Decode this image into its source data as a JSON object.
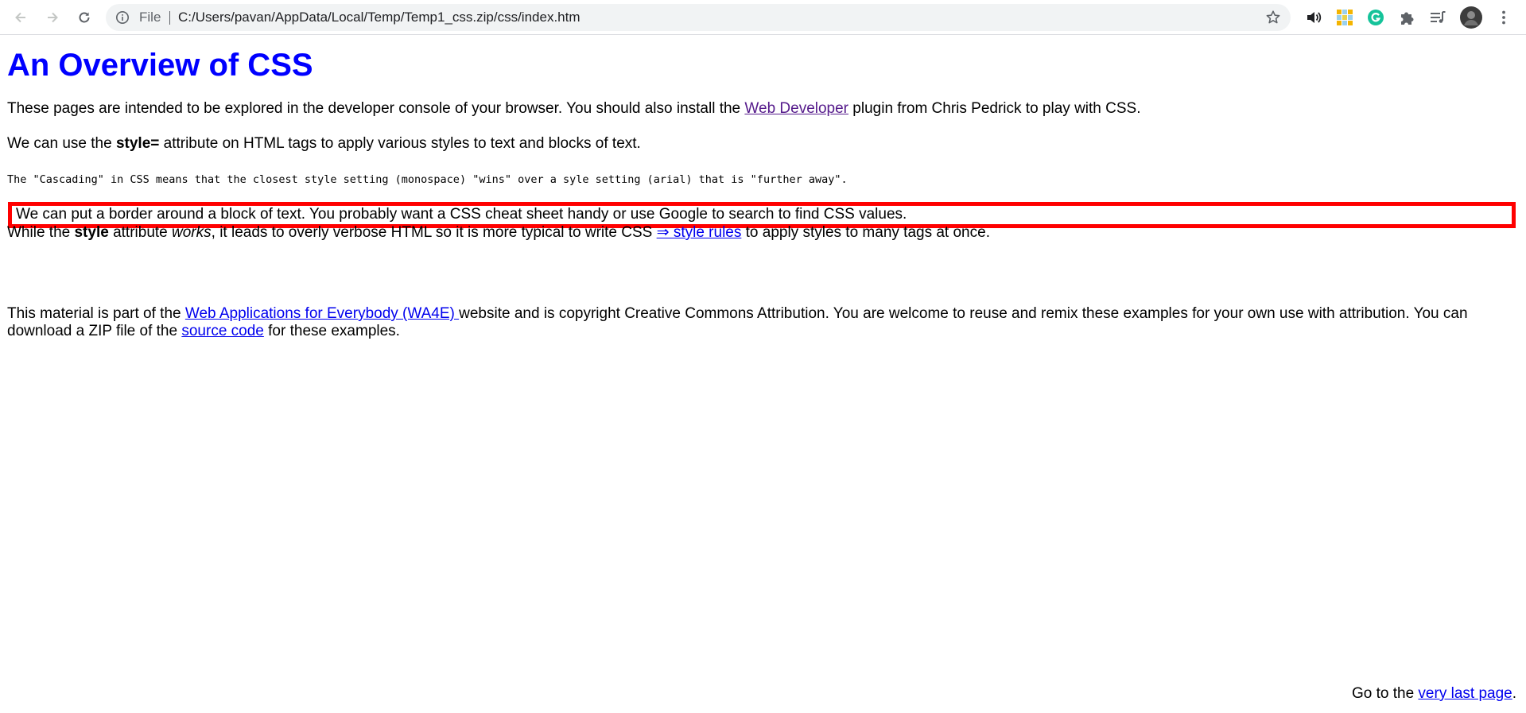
{
  "browser": {
    "url_scheme": "File",
    "url": "C:/Users/pavan/AppData/Local/Temp/Temp1_css.zip/css/index.htm"
  },
  "icons": {
    "back": "arrow-left-icon",
    "forward": "arrow-right-icon",
    "reload": "reload-icon",
    "info": "info-icon",
    "bookmark": "star-icon",
    "audio": "speaker-icon",
    "extension_color": "colorful-extension-icon",
    "grammarly": "grammarly-icon",
    "extensions": "puzzle-icon",
    "media": "media-queue-icon",
    "profile": "avatar",
    "menu": "kebab-menu-icon"
  },
  "colors": {
    "heading": "#0000ff",
    "border_box": "#ff0000",
    "link": "#0000ee",
    "visited_link": "#551a8b",
    "grammarly_green": "#15c39a"
  },
  "content": {
    "title": "An Overview of CSS",
    "p1": {
      "before": "These pages are intended to be explored in the developer console of your browser. You should also install the ",
      "link": "Web Developer",
      "after": " plugin from Chris Pedrick to play with CSS."
    },
    "p2": {
      "before": "We can use the ",
      "bold": "style=",
      "after": " attribute on HTML tags to apply various styles to text and blocks of text."
    },
    "p3": "The \"Cascading\" in CSS means that the closest style setting (monospace) \"wins\" over a syle setting (arial) that is \"further away\".",
    "p4": "We can put a border around a block of text. You probably want a CSS cheat sheet handy or use Google to search to find CSS values.",
    "p5": {
      "before": "While the ",
      "bold": "style",
      "middle": " attribute ",
      "italic": "works",
      "after_italic": ", it leads to overly verbose HTML so it is more typical to write CSS ",
      "link": "⇒ style rules",
      "after": " to apply styles to many tags at once."
    },
    "p6": {
      "before": "This material is part of the ",
      "link1": "Web Applications for Everybody (WA4E) ",
      "middle": "website and is copyright Creative Commons Attribution. You are welcome to reuse and remix these examples for your own use with attribution. You can download a ZIP file of the ",
      "link2": "source code",
      "after": " for these examples."
    },
    "footer": {
      "before": "Go to the ",
      "link": "very last page",
      "after": "."
    }
  }
}
